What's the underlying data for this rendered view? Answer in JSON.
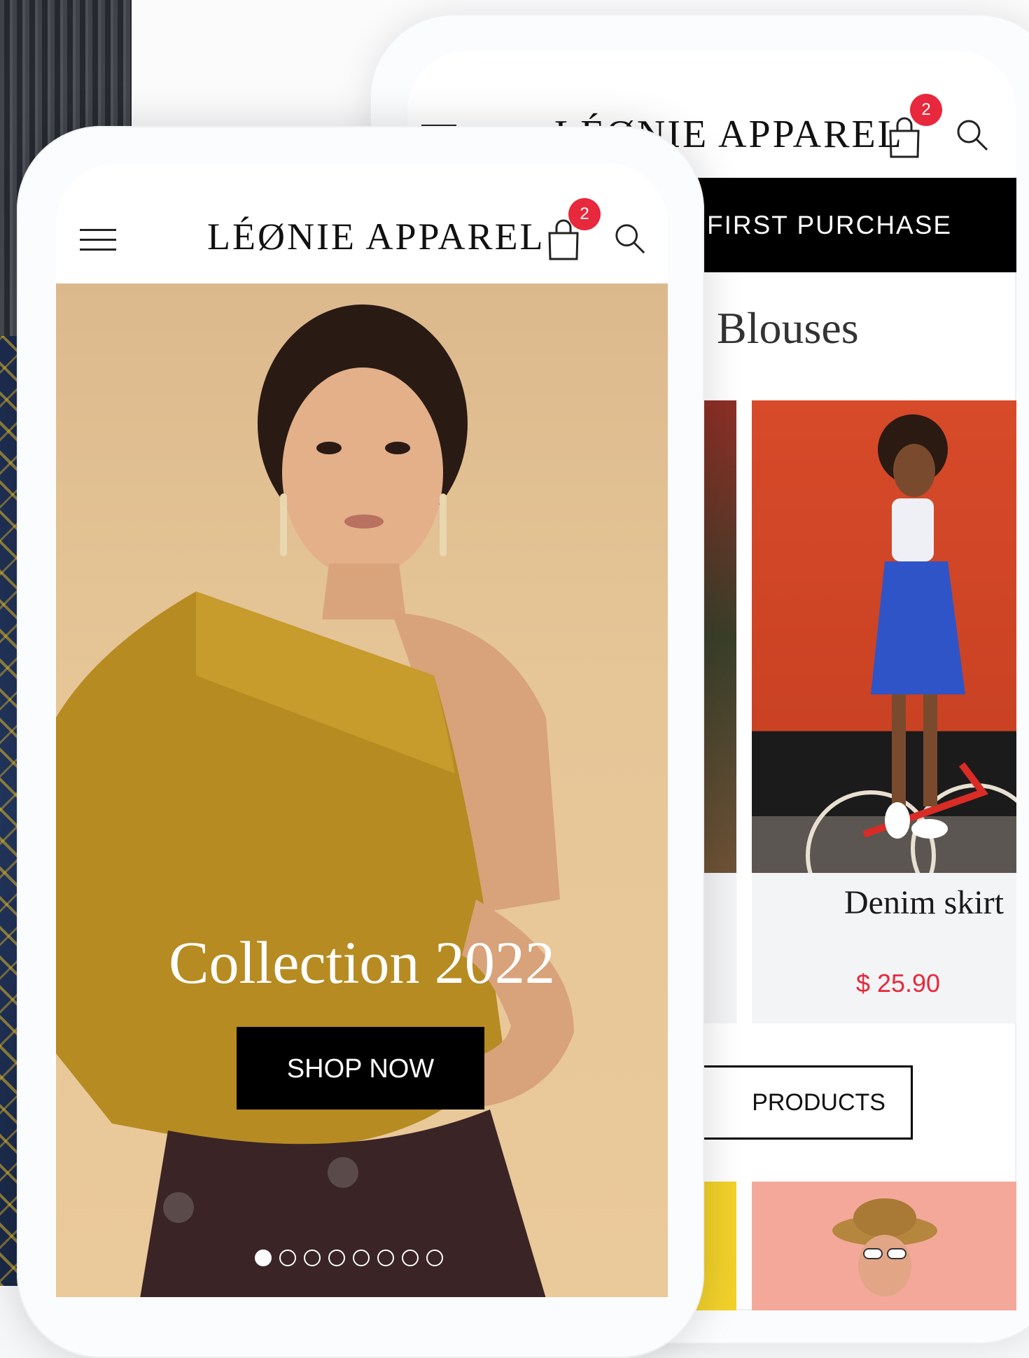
{
  "brand": "LÉØNIE APPAREL",
  "colors": {
    "accent": "#e8283c",
    "primary_button": "#000000"
  },
  "back_phone": {
    "logo": "LÉØNIE APPAREL",
    "cart_count": "2",
    "promo_text": "FIRST PURCHASE",
    "section_title": "Blouses",
    "products": [
      {
        "name": "Denim skirt",
        "price": "$ 25.90"
      }
    ],
    "view_button": "PRODUCTS"
  },
  "front_phone": {
    "logo": "LÉØNIE APPAREL",
    "cart_count": "2",
    "hero_title": "Collection 2022",
    "shop_button": "SHOP NOW",
    "carousel": {
      "total": 8,
      "active": 1
    }
  },
  "icons": [
    "menu-icon",
    "shopping-bag-icon",
    "search-icon"
  ]
}
